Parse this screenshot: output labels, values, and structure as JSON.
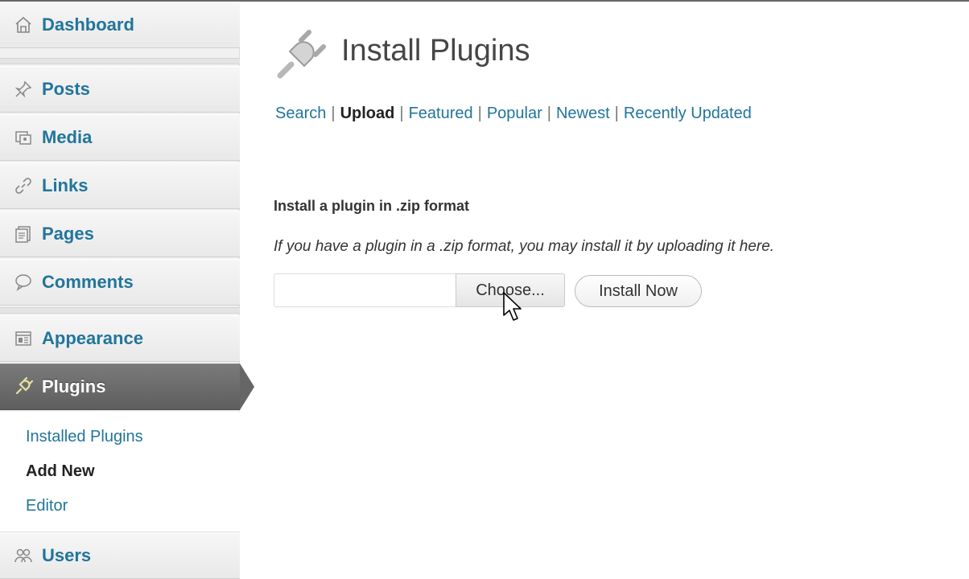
{
  "sidebar": {
    "items": [
      {
        "label": "Dashboard",
        "icon": "dashboard-icon"
      },
      {
        "label": "Posts",
        "icon": "pushpin-icon"
      },
      {
        "label": "Media",
        "icon": "media-icon"
      },
      {
        "label": "Links",
        "icon": "links-icon"
      },
      {
        "label": "Pages",
        "icon": "pages-icon"
      },
      {
        "label": "Comments",
        "icon": "comments-icon"
      },
      {
        "label": "Appearance",
        "icon": "appearance-icon"
      },
      {
        "label": "Plugins",
        "icon": "plugins-icon"
      },
      {
        "label": "Users",
        "icon": "users-icon"
      }
    ],
    "submenu": [
      {
        "label": "Installed Plugins"
      },
      {
        "label": "Add New"
      },
      {
        "label": "Editor"
      }
    ]
  },
  "main": {
    "title": "Install Plugins",
    "subnav": [
      "Search",
      "Upload",
      "Featured",
      "Popular",
      "Newest",
      "Recently Updated"
    ],
    "section_heading": "Install a plugin in .zip format",
    "section_desc": "If you have a plugin in a .zip format, you may install it by uploading it here.",
    "file_input": {
      "value": "",
      "button_label": "Choose..."
    },
    "install_button": "Install Now"
  },
  "colors": {
    "link": "#21759b",
    "active_menu": "#6d6d6d"
  }
}
